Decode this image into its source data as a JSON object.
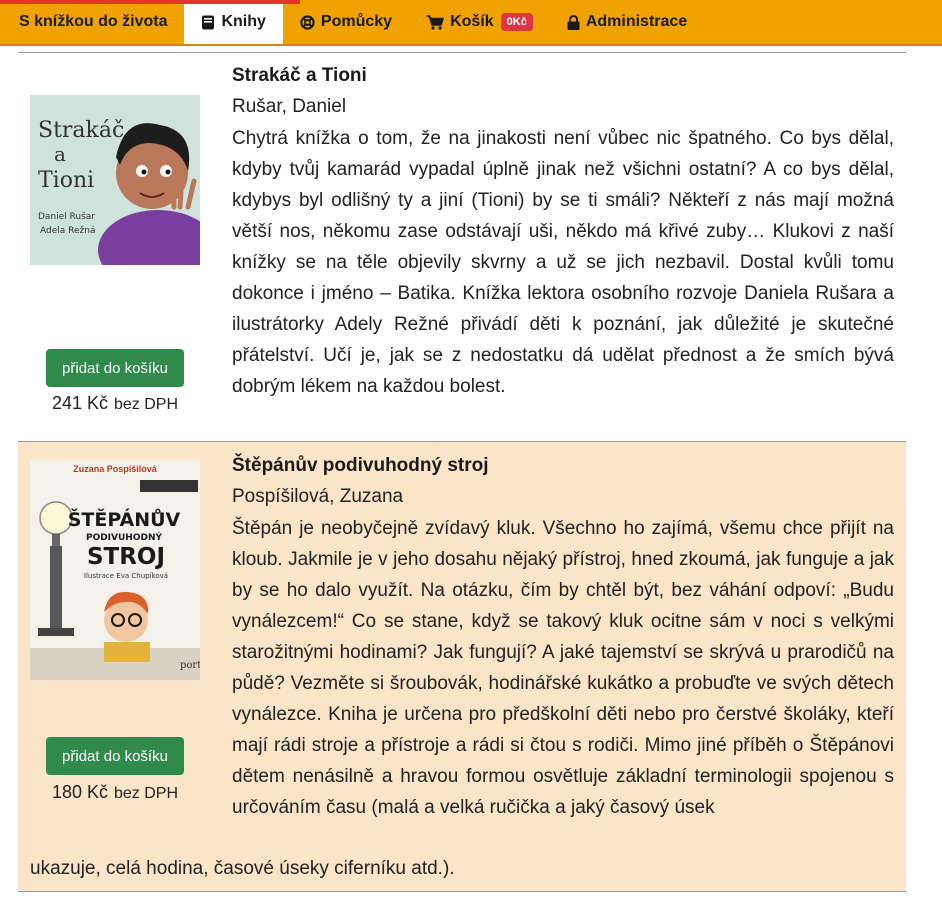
{
  "nav": {
    "brand": "S knížkou do života",
    "items": [
      {
        "label": "Knihy",
        "icon": "book-icon",
        "active": true
      },
      {
        "label": "Pomůcky",
        "icon": "lifebuoy-icon",
        "active": false
      },
      {
        "label": "Košík",
        "icon": "cart-icon",
        "active": false,
        "badge": "0Kč"
      },
      {
        "label": "Administrace",
        "icon": "lock-icon",
        "active": false
      }
    ]
  },
  "colors": {
    "nav_bg": "#f0a300",
    "active_tab": "#ffffff",
    "badge": "#dc3545",
    "button": "#2f8a4b",
    "alt_row": "#fbe5c8"
  },
  "books": [
    {
      "title": "Strakáč a Tioni",
      "author": "Rušar, Daniel",
      "description": "Chytrá knížka o tom, že na jinakosti není vůbec nic špatného. Co bys dělal, kdyby tvůj kamarád vypadal úplně jinak než všichni ostatní? A co bys dělal, kdybys byl odlišný ty a jiní (Tioni) by se ti smáli? Někteří z nás mají možná větší nos, někomu zase odstávají uši, někdo má křivé zuby… Klukovi z naší knížky se na těle objevily skvrny a už se jich nezbavil. Dostal kvůli tomu dokonce i jméno – Batika. Knížka lektora osobního rozvoje Daniela Rušara a ilustrátorky Adely Režné přivádí děti k poznání, jak důležité je skutečné přátelství. Učí je, jak se z nedostatku dá udělat přednost a že smích bývá dobrým lékem na každou bolest.",
      "button": "přidat do košíku",
      "price": "241 Kč",
      "price_unit": "bez DPH",
      "cover": {
        "title_lines": [
          "Strakáč",
          "a",
          "Tioni"
        ],
        "authors": [
          "Daniel Rušar",
          "Adela Režná"
        ]
      }
    },
    {
      "title": "Štěpánův podivuhodný stroj",
      "author": "Pospíšilová, Zuzana",
      "description_main": "Štěpán je neobyčejně zvídavý kluk. Všechno ho zajímá, všemu chce přijít na kloub. Jakmile je v jeho dosahu nějaký přístroj, hned zkoumá, jak funguje a jak by se ho dalo využít. Na otázku, čím by chtěl být, bez váhání odpoví: „Budu vynálezcem!“ Co se stane, když se takový kluk ocitne sám v noci s velkými starožitnými hodinami? Jak fungují? A jaké tajemství se skrývá u prarodičů na půdě? Vezměte si šroubovák, hodinářské kukátko a probuďte ve svých dětech vynálezce. Kniha je určena pro předškolní děti nebo pro čerstvé školáky, kteří mají rádi stroje a přístroje a rádi si čtou s rodiči. Mimo jiné příběh o Štěpánovi dětem nenásilně a hravou formou osvětluje základní terminologii spojenou s určováním času (malá a velká ručička a jaký časový úsek",
      "description_tail": "ukazuje, celá hodina, časové úseky ciferníku atd.).",
      "button": "přidat do košíku",
      "price": "180 Kč",
      "price_unit": "bez DPH",
      "cover": {
        "author": "Zuzana Pospíšilová",
        "title_lines": [
          "ŠTĚPÁNŮV",
          "PODIVUHODNÝ",
          "STROJ"
        ],
        "illustrator": "Ilustrace Eva Chupíková",
        "publisher": "portál"
      }
    }
  ]
}
